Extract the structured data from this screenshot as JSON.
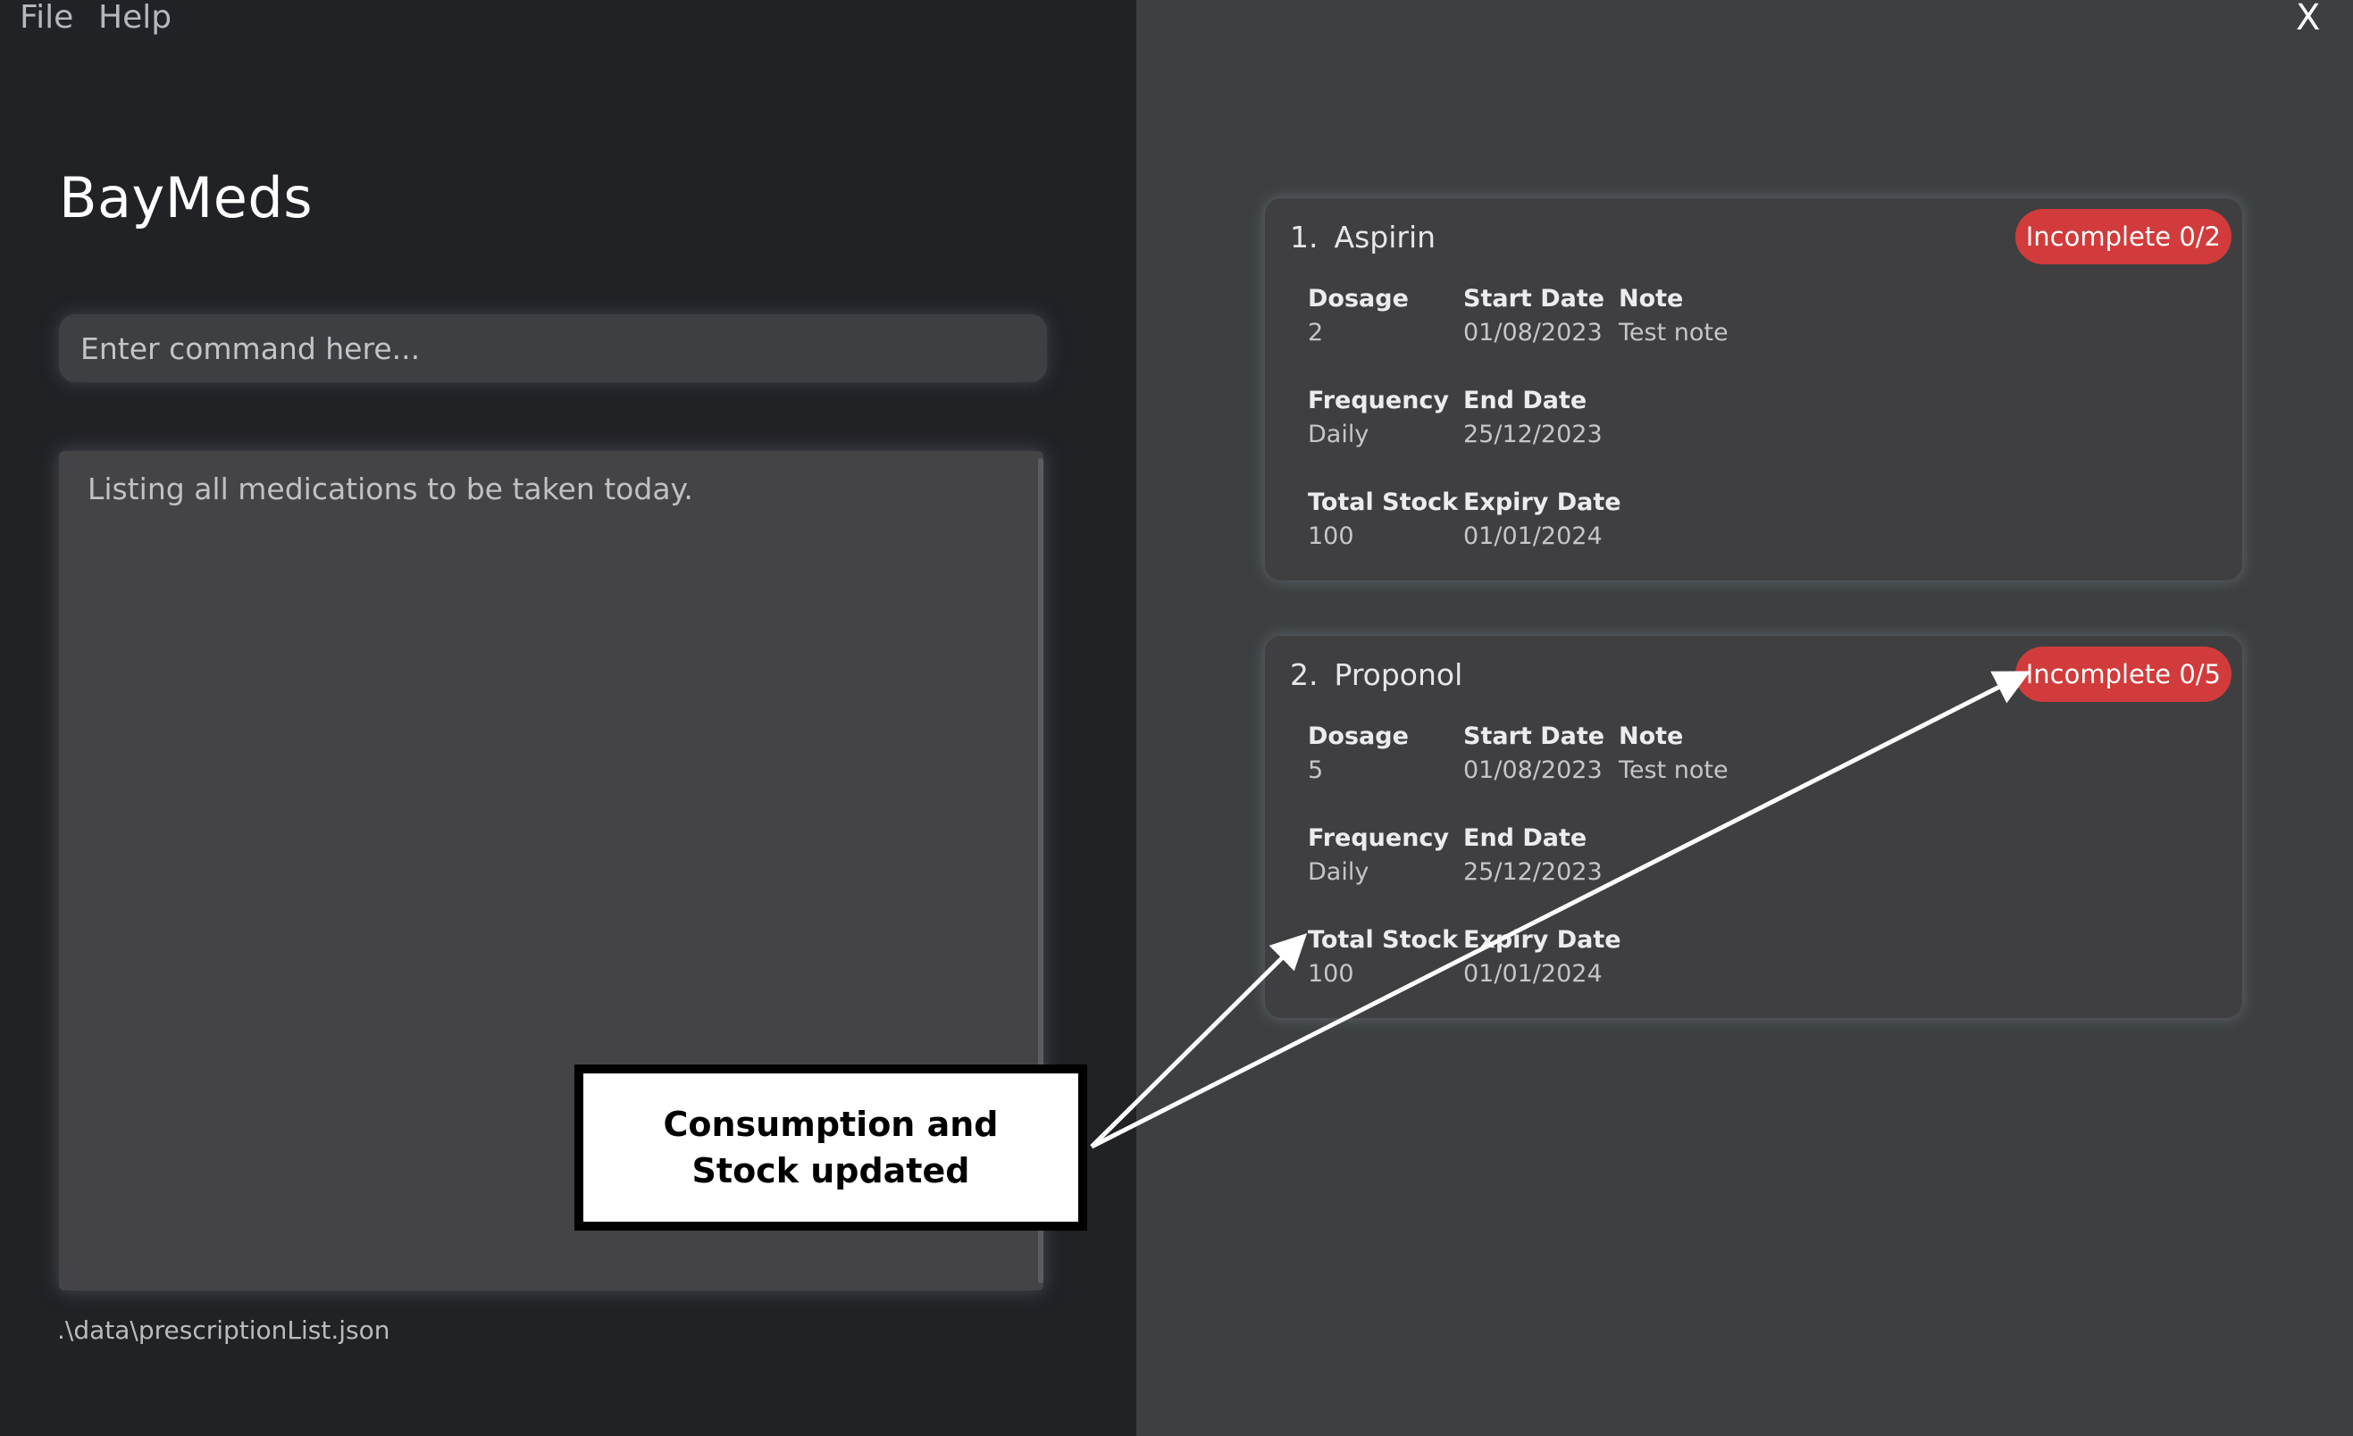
{
  "menu": {
    "file_label": "File",
    "help_label": "Help"
  },
  "window": {
    "close_label": "X"
  },
  "app": {
    "title": "BayMeds"
  },
  "command": {
    "placeholder": "Enter command here...",
    "value": ""
  },
  "result": {
    "text": "Listing all medications to be taken today."
  },
  "status": {
    "path": ".\\data\\prescriptionList.json"
  },
  "labels": {
    "dosage": "Dosage",
    "start_date": "Start Date",
    "note": "Note",
    "frequency": "Frequency",
    "end_date": "End Date",
    "total_stock": "Total Stock",
    "expiry_date": "Expiry Date"
  },
  "medications": [
    {
      "index": "1.",
      "name": "Aspirin",
      "status": "Incomplete 0/2",
      "dosage": "2",
      "start_date": "01/08/2023",
      "note": "Test note",
      "frequency": "Daily",
      "end_date": "25/12/2023",
      "total_stock": "100",
      "expiry_date": "01/01/2024"
    },
    {
      "index": "2.",
      "name": "Proponol",
      "status": "Incomplete 0/5",
      "dosage": "5",
      "start_date": "01/08/2023",
      "note": "Test note",
      "frequency": "Daily",
      "end_date": "25/12/2023",
      "total_stock": "100",
      "expiry_date": "01/01/2024"
    }
  ],
  "annotation": {
    "text": "Consumption and Stock updated"
  },
  "colors": {
    "left_panel_bg": "#212226",
    "right_panel_bg": "#3d4042",
    "card_bg": "#3f3f41",
    "badge_incomplete": "#d23b3b"
  }
}
